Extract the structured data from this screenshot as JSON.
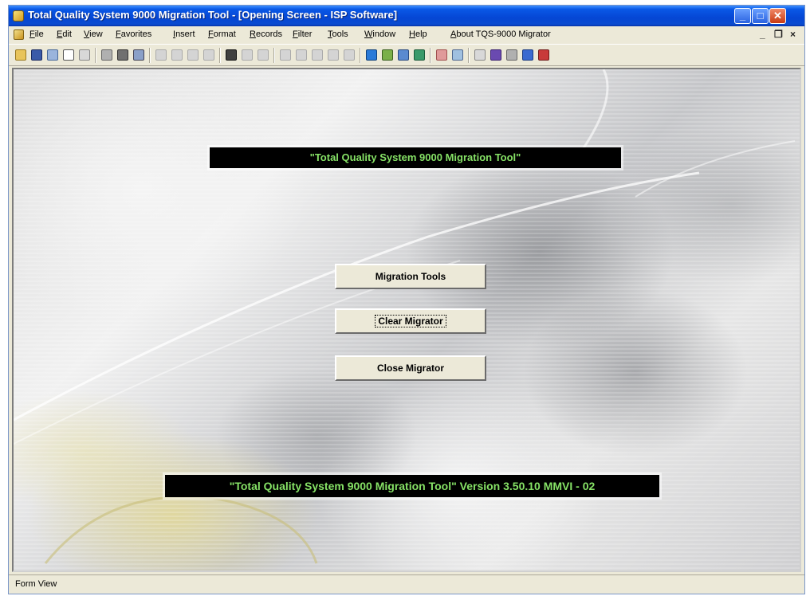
{
  "window": {
    "title": "Total Quality System 9000 Migration Tool - [Opening Screen - ISP Software]",
    "controls": {
      "minimize": "_",
      "maximize": "□",
      "close": "✕"
    }
  },
  "menubar": {
    "items": [
      "File",
      "Edit",
      "View",
      "Favorites",
      "Insert",
      "Format",
      "Records",
      "Filter",
      "Tools",
      "Window",
      "Help",
      "About TQS-9000 Migrator"
    ],
    "mdi_controls": {
      "minimize": "_",
      "restore": "❐",
      "close": "×"
    }
  },
  "toolbar": {
    "icons": [
      "open-icon",
      "save-icon",
      "file-search-icon",
      "print-preview-icon",
      "view-icon",
      "spelling-icon",
      "print-icon",
      "email-icon",
      "undo-icon",
      "cut-icon",
      "copy-icon",
      "paste-icon",
      "find-icon",
      "sort-ascending-icon",
      "sort-descending-icon",
      "filter-by-selection-icon",
      "filter-by-form-icon",
      "apply-filter-icon",
      "toggle-filter-icon",
      "delete-icon",
      "database-window-icon",
      "new-object-icon",
      "office-links-icon",
      "web-icon",
      "relationships-icon",
      "analyze-icon",
      "properties-icon",
      "format-icon",
      "spelling-check-icon",
      "help-icon",
      "security-icon"
    ]
  },
  "form": {
    "banner_title": "\"Total Quality System 9000 Migration Tool\"",
    "buttons": {
      "migration_tools": "Migration Tools",
      "clear_migrator": "Clear Migrator",
      "close_migrator": "Close Migrator"
    },
    "version_banner": "\"Total Quality System 9000 Migration Tool\" Version 3.50.10 MMVI - 02"
  },
  "statusbar": {
    "text": "Form View"
  },
  "colors": {
    "banner_text": "#86e266",
    "banner_background": "#000000",
    "titlebar": "#0546d4"
  }
}
